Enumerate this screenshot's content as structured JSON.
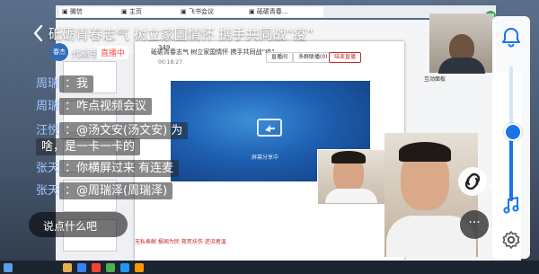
{
  "stream": {
    "title": "砥砺青春志气 树立家国情怀  携手共同战“疫”",
    "host_avatar_text": "春杰",
    "host_name": "代新宇",
    "live_badge": "直播中"
  },
  "chat": [
    {
      "name": "周瑞",
      "text": "：我"
    },
    {
      "name": "周瑞",
      "text": "：咋点视频会议"
    },
    {
      "name": "汪悦",
      "text": "：@汤文安(汤文安) 为"
    },
    {
      "name": "",
      "text": "啥，是一卡一卡的"
    },
    {
      "name": "张天",
      "text": "：你横屏过来 有连麦"
    },
    {
      "name": "张天",
      "text": "：@周瑞泽(周瑞泽)"
    }
  ],
  "comment_input": {
    "placeholder": "说点什么吧"
  },
  "side": {
    "share_label": "连",
    "more_label": "···"
  },
  "desktop": {
    "meeting_id": "349",
    "meeting_title": "砥砺青春志气 树立家国情怀  携手共同战“疫”",
    "meeting_time": "00:18:27",
    "buttons": [
      "直播间",
      "多群联播(0)",
      "结束直播"
    ],
    "share_label": "屏幕分享中",
    "bottom_links": "无私奉献  报国为民  救死扶伤  逆流者温",
    "right_tab": "互动面板",
    "tabs": [
      "▣ 微信",
      "▣ 主页",
      "▣ 飞书会议",
      "▣ 砥砺青春..."
    ]
  },
  "colors": {
    "accent": "#1a73e8",
    "live": "#ff4d4d"
  }
}
